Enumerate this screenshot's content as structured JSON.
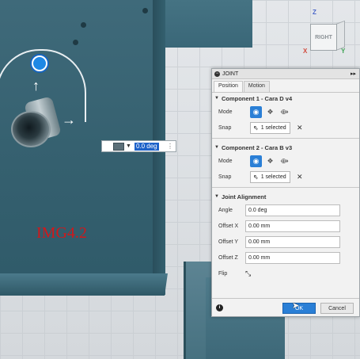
{
  "viewport": {
    "image_label": "IMG4.2",
    "angle_field_value": "0.0 deg"
  },
  "viewcube": {
    "face_label": "RIGHT",
    "axis_z": "Z",
    "axis_x": "X",
    "axis_y": "Y"
  },
  "panel": {
    "title": "JOINT",
    "tabs": [
      "Position",
      "Motion"
    ],
    "component1": {
      "header": "Component 1 - Cara D v4",
      "mode_label": "Mode",
      "snap_label": "Snap",
      "snap_value": "1 selected"
    },
    "component2": {
      "header": "Component 2 - Cara B v3",
      "mode_label": "Mode",
      "snap_label": "Snap",
      "snap_value": "1 selected"
    },
    "alignment": {
      "header": "Joint Alignment",
      "angle_label": "Angle",
      "angle_value": "0.0 deg",
      "offset_x_label": "Offset X",
      "offset_x_value": "0.00 mm",
      "offset_y_label": "Offset Y",
      "offset_y_value": "0.00 mm",
      "offset_z_label": "Offset Z",
      "offset_z_value": "0.00 mm",
      "flip_label": "Flip"
    },
    "footer": {
      "ok_label": "OK",
      "cancel_label": "Cancel"
    }
  },
  "colors": {
    "accent": "#2a7fd6",
    "part_teal": "#3f6a7a",
    "label_red": "#d0181b"
  }
}
